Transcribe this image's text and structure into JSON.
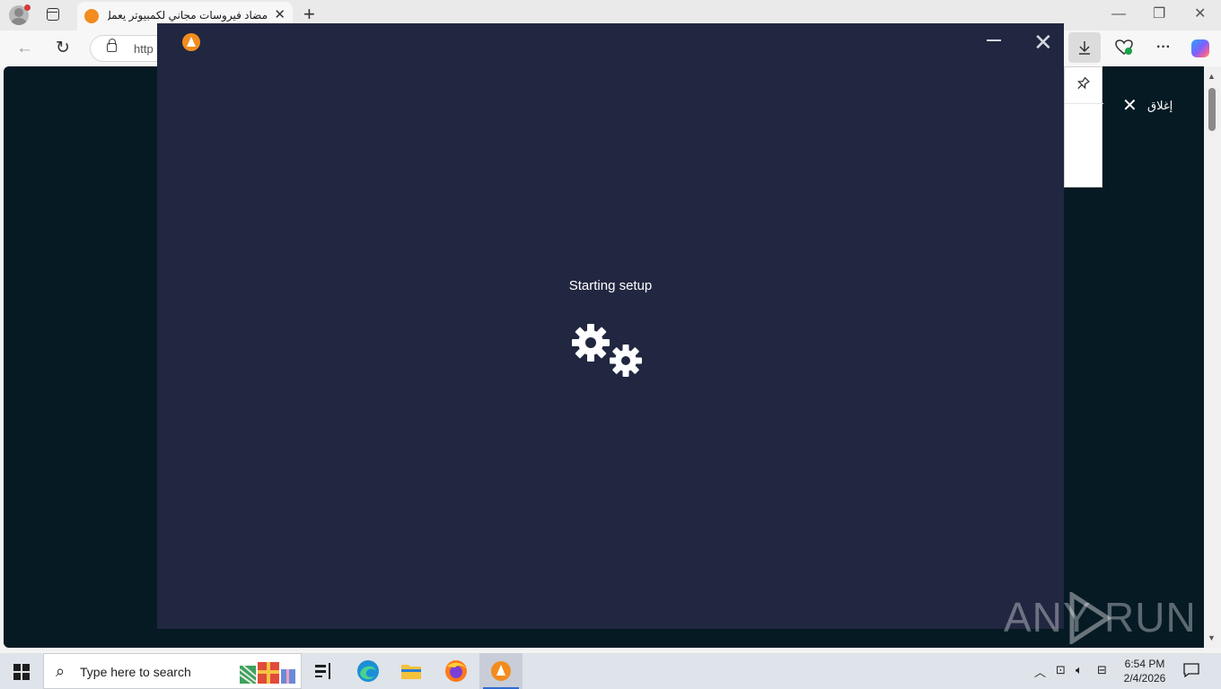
{
  "browser": {
    "tab_title": "مضاد فيروسات مجاني لكمبيوتر يعمل",
    "tab_close": "✕",
    "new_tab": "+",
    "url_partial": "http",
    "window_minimize": "—",
    "window_restore": "❐",
    "window_close": "✕"
  },
  "page": {
    "close_label": "إغلاق",
    "close_x": "✕"
  },
  "installer": {
    "status": "Starting setup",
    "minimize": "",
    "close": "✕"
  },
  "watermark": {
    "left": "ANY",
    "right": "RUN"
  },
  "taskbar": {
    "search_placeholder": "Type here to search",
    "time": "6:54 PM",
    "date": "2/4/2026"
  },
  "colors": {
    "installer_bg": "#212740",
    "page_bg": "#061a24",
    "brand_orange": "#f28c1e"
  }
}
